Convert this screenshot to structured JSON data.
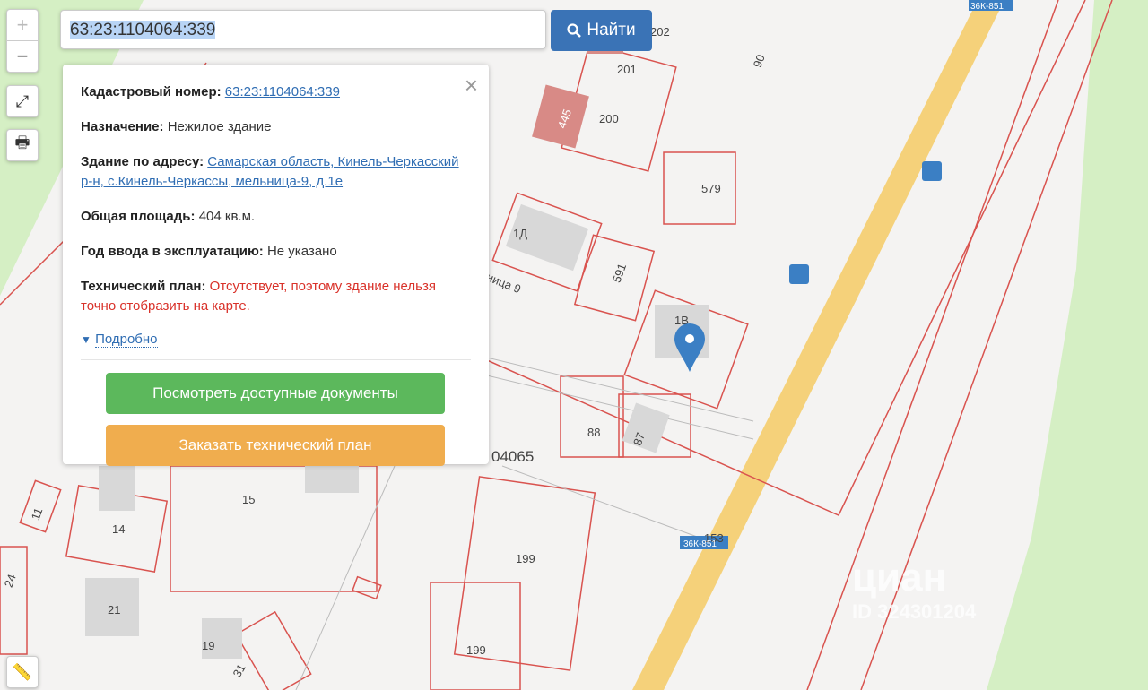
{
  "search": {
    "value": "63:23:1104064:339",
    "button_label": "Найти",
    "button_icon": "search-icon"
  },
  "controls": {
    "zoom_in": "+",
    "zoom_out": "−",
    "fullscreen_icon": "expand-icon",
    "print_icon": "print-icon",
    "ruler_icon": "ruler-icon"
  },
  "popup": {
    "cadastral_label": "Кадастровый номер:",
    "cadastral_value": "63:23:1104064:339",
    "purpose_label": "Назначение:",
    "purpose_value": "Нежилое здание",
    "address_label": "Здание по адресу:",
    "address_value": "Самарская область, Кинель-Черкасский р-н, с.Кинель-Черкассы, мельница-9, д.1е",
    "area_label": "Общая площадь:",
    "area_value": "404 кв.м.",
    "year_label": "Год ввода в эксплуатацию:",
    "year_value": "Не указано",
    "plan_label": "Технический план:",
    "plan_value": "Отсутствует, поэтому здание нельзя точно отобразить на карте.",
    "more_label": "Подробно",
    "docs_button": "Посмотреть доступные документы",
    "order_button": "Заказать технический план"
  },
  "map": {
    "labels": [
      "202",
      "201",
      "200",
      "90",
      "445",
      "579",
      "1Д",
      "591",
      "ница 9",
      "1В",
      "88",
      "87",
      "04065",
      "15",
      "14",
      "11",
      "24",
      "21",
      "19",
      "31",
      "199",
      "199",
      "153",
      "36К-851",
      "36К-851"
    ],
    "colors": {
      "parcel": "#d9534f",
      "road": "#f5d17a",
      "green": "#d5efc4",
      "building": "#d8d8d8",
      "marker": "#3b7fc4"
    }
  },
  "watermark": {
    "brand": "циан",
    "id": "ID 324301204"
  }
}
